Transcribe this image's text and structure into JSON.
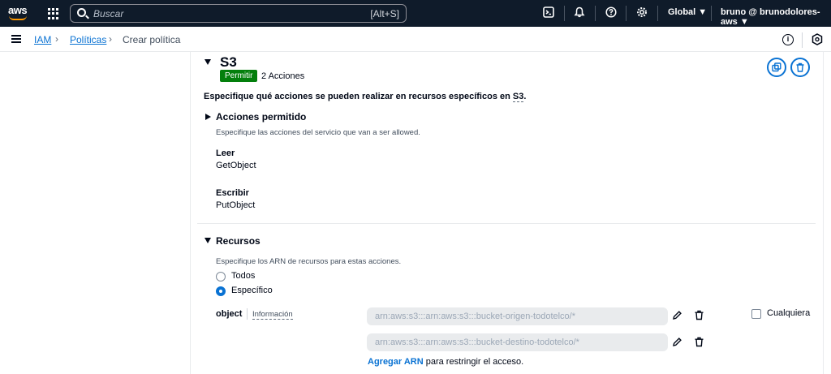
{
  "topbar": {
    "logo_text": "aws",
    "search_placeholder": "Buscar",
    "search_shortcut": "[Alt+S]",
    "region_label": "Global ▼",
    "account_label": "bruno @ brunodolores-aws ▼"
  },
  "breadcrumbs": [
    "IAM",
    "Políticas",
    "Crear política"
  ],
  "service": {
    "name": "S3",
    "effect_badge": "Permitir",
    "actions_count": "2 Acciones",
    "intro_prefix": "Especifique qué acciones se pueden realizar en recursos específicos en ",
    "intro_service": "S3",
    "intro_suffix": "."
  },
  "allowed_actions": {
    "title": "Acciones permitido",
    "description": "Especifique las acciones del servicio que van a ser allowed.",
    "groups": [
      {
        "label": "Leer",
        "value": "GetObject"
      },
      {
        "label": "Escribir",
        "value": "PutObject"
      }
    ]
  },
  "resources": {
    "title": "Recursos",
    "description": "Especifique los ARN de recursos para estas acciones.",
    "option_all": "Todos",
    "option_specific": "Específico",
    "selected": "Específico",
    "resource_type": "object",
    "info_link": "Información",
    "arns": [
      "arn:aws:s3:::arn:aws:s3:::bucket-origen-todotelco/*",
      "arn:aws:s3:::arn:aws:s3:::bucket-destino-todotelco/*"
    ],
    "any_label": "Cualquiera",
    "add_arn_link": "Agregar ARN",
    "add_arn_suffix": " para restringir el acceso."
  },
  "colors": {
    "topbar_bg": "#0f1b2a",
    "link": "#0972d3",
    "badge_green": "#037f0c"
  }
}
